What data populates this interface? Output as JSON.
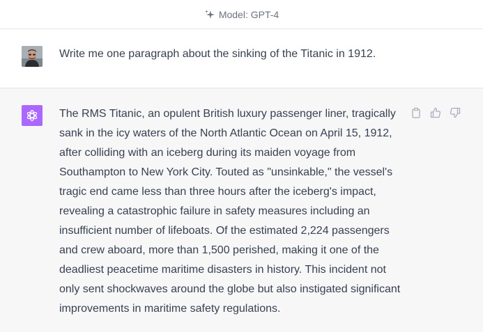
{
  "header": {
    "model_label": "Model: GPT-4",
    "icon": "sparkles-icon"
  },
  "conversation": {
    "user_message": {
      "avatar": "user-avatar",
      "text": "Write me one paragraph about the sinking of the Titanic in 1912."
    },
    "assistant_message": {
      "avatar": "openai-logo-icon",
      "avatar_color": "#ab68ff",
      "text": "The RMS Titanic, an opulent British luxury passenger liner, tragically sank in the icy waters of the North Atlantic Ocean on April 15, 1912, after colliding with an iceberg during its maiden voyage from Southampton to New York City. Touted as \"unsinkable,\" the vessel's tragic end came less than three hours after the iceberg's impact, revealing a catastrophic failure in safety measures including an insufficient number of lifeboats. Of the estimated 2,224 passengers and crew aboard, more than 1,500 perished, making it one of the deadliest peacetime maritime disasters in history. This incident not only sent shockwaves around the globe but also instigated significant improvements in maritime safety regulations.",
      "actions": [
        "copy-icon",
        "thumbs-up-icon",
        "thumbs-down-icon"
      ]
    }
  },
  "colors": {
    "assistant_bg": "#f7f7f8",
    "text": "#374151",
    "muted": "#6b7280",
    "icon": "#acacbe"
  }
}
